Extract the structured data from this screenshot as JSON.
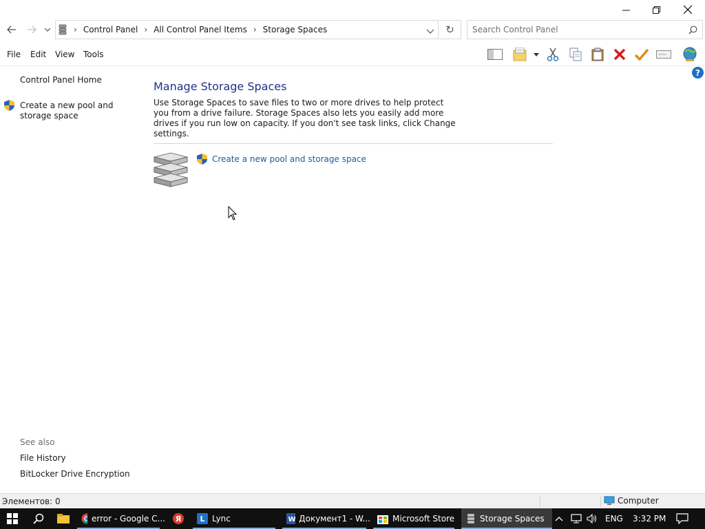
{
  "window": {
    "minimize_icon": "minimize-icon",
    "maximize_icon": "restore-icon",
    "close_icon": "close-icon"
  },
  "nav": {
    "breadcrumb": [
      "Control Panel",
      "All Control Panel Items",
      "Storage Spaces"
    ],
    "search_placeholder": "Search Control Panel"
  },
  "menu": [
    "File",
    "Edit",
    "View",
    "Tools"
  ],
  "left": {
    "home": "Control Panel Home",
    "create_task": "Create a new pool and storage space",
    "see_also": "See also",
    "file_history": "File History",
    "bitlocker": "BitLocker Drive Encryption"
  },
  "main": {
    "title": "Manage Storage Spaces",
    "description": "Use Storage Spaces to save files to two or more drives to help protect you from a drive failure. Storage Spaces also lets you easily add more drives if you run low on capacity. If you don't see task links, click Change settings.",
    "task_link": "Create a new pool and storage space"
  },
  "status": {
    "items": "Элементов: 0",
    "location": "Computer"
  },
  "taskbar": {
    "apps": [
      "error - Google C...",
      "Lync",
      "Документ1 - W...",
      "Microsoft Store",
      "Storage Spaces"
    ],
    "lang": "ENG",
    "time": "3:32 PM"
  },
  "colors": {
    "title_blue": "#1e3287",
    "link_blue": "#1f5a96",
    "taskbar": "#101010"
  }
}
